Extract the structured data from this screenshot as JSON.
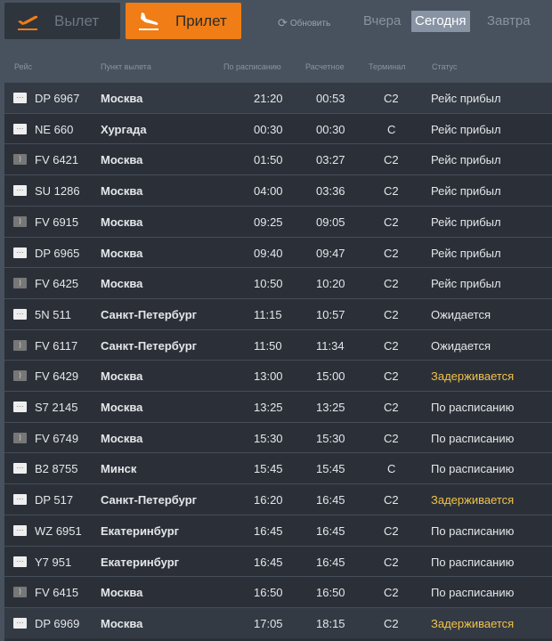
{
  "tabs": {
    "departure": "Вылет",
    "arrival": "Прилет"
  },
  "refresh": "Обновить",
  "days": [
    "Вчера",
    "Сегодня",
    "Завтра"
  ],
  "active_day": "Сегодня",
  "columns": [
    "Рейс",
    "Пункт вылета",
    "По расписанию",
    "Расчетное",
    "Терминал",
    "Статус"
  ],
  "colors": {
    "accent": "#f07d16",
    "delayed": "#f2c24a"
  },
  "flights": [
    {
      "flight": "DP 6967",
      "from": "Москва",
      "sched": "21:20",
      "est": "00:53",
      "term": "C2",
      "status": "Рейс прибыл",
      "logo": "dp"
    },
    {
      "flight": "NE 660",
      "from": "Хургада",
      "sched": "00:30",
      "est": "00:30",
      "term": "C",
      "status": "Рейс прибыл",
      "logo": "ne"
    },
    {
      "flight": "FV 6421",
      "from": "Москва",
      "sched": "01:50",
      "est": "03:27",
      "term": "C2",
      "status": "Рейс прибыл",
      "logo": "fv"
    },
    {
      "flight": "SU 1286",
      "from": "Москва",
      "sched": "04:00",
      "est": "03:36",
      "term": "C2",
      "status": "Рейс прибыл",
      "logo": "su"
    },
    {
      "flight": "FV 6915",
      "from": "Москва",
      "sched": "09:25",
      "est": "09:05",
      "term": "C2",
      "status": "Рейс прибыл",
      "logo": "fv"
    },
    {
      "flight": "DP 6965",
      "from": "Москва",
      "sched": "09:40",
      "est": "09:47",
      "term": "C2",
      "status": "Рейс прибыл",
      "logo": "dp"
    },
    {
      "flight": "FV 6425",
      "from": "Москва",
      "sched": "10:50",
      "est": "10:20",
      "term": "C2",
      "status": "Рейс прибыл",
      "logo": "fv"
    },
    {
      "flight": "5N 511",
      "from": "Санкт-Петербург",
      "sched": "11:15",
      "est": "10:57",
      "term": "C2",
      "status": "Ожидается",
      "logo": "5n"
    },
    {
      "flight": "FV 6117",
      "from": "Санкт-Петербург",
      "sched": "11:50",
      "est": "11:34",
      "term": "C2",
      "status": "Ожидается",
      "logo": "fv"
    },
    {
      "flight": "FV 6429",
      "from": "Москва",
      "sched": "13:00",
      "est": "15:00",
      "term": "C2",
      "status": "Задерживается",
      "logo": "fv"
    },
    {
      "flight": "S7 2145",
      "from": "Москва",
      "sched": "13:25",
      "est": "13:25",
      "term": "C2",
      "status": "По расписанию",
      "logo": "s7"
    },
    {
      "flight": "FV 6749",
      "from": "Москва",
      "sched": "15:30",
      "est": "15:30",
      "term": "C2",
      "status": "По расписанию",
      "logo": "fv"
    },
    {
      "flight": "B2 8755",
      "from": "Минск",
      "sched": "15:45",
      "est": "15:45",
      "term": "C",
      "status": "По расписанию",
      "logo": "b2"
    },
    {
      "flight": "DP 517",
      "from": "Санкт-Петербург",
      "sched": "16:20",
      "est": "16:45",
      "term": "C2",
      "status": "Задерживается",
      "logo": "dp"
    },
    {
      "flight": "WZ 6951",
      "from": "Екатеринбург",
      "sched": "16:45",
      "est": "16:45",
      "term": "C2",
      "status": "По расписанию",
      "logo": "wz"
    },
    {
      "flight": "Y7 951",
      "from": "Екатеринбург",
      "sched": "16:45",
      "est": "16:45",
      "term": "C2",
      "status": "По расписанию",
      "logo": "y7"
    },
    {
      "flight": "FV 6415",
      "from": "Москва",
      "sched": "16:50",
      "est": "16:50",
      "term": "C2",
      "status": "По расписанию",
      "logo": "fv"
    },
    {
      "flight": "DP 6969",
      "from": "Москва",
      "sched": "17:05",
      "est": "18:15",
      "term": "C2",
      "status": "Задерживается",
      "logo": "dp"
    }
  ]
}
